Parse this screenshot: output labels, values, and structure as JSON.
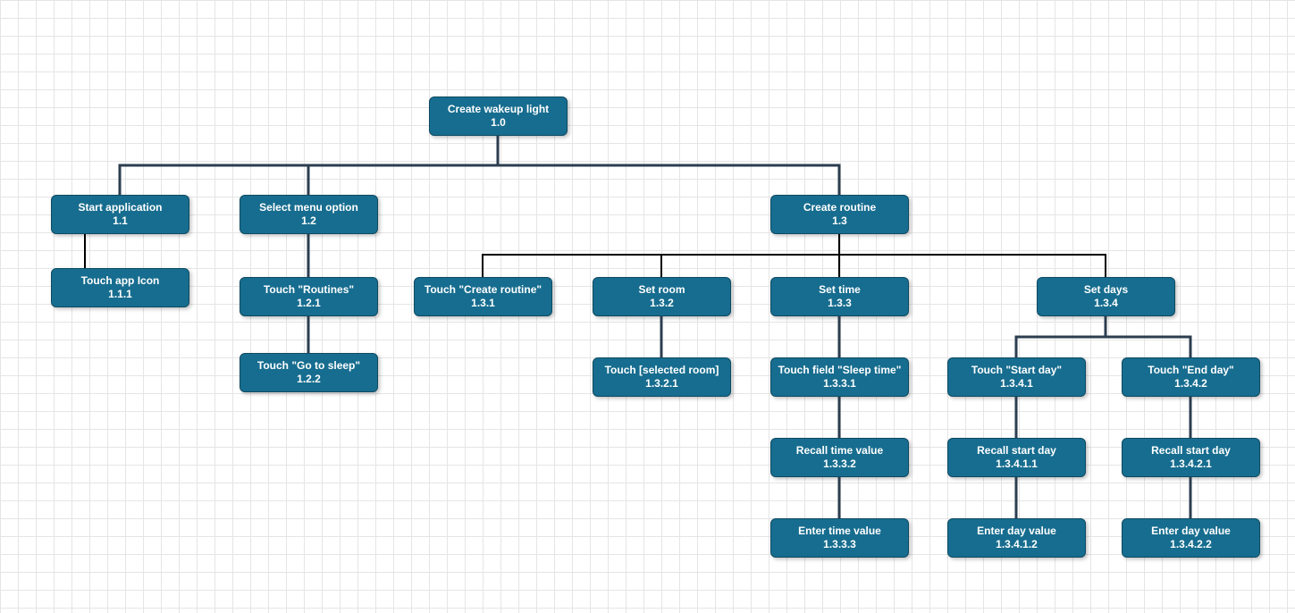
{
  "colors": {
    "node_fill": "#176D8F",
    "edge_stroke": "#2c3e50",
    "edge_alt_stroke": "#000000"
  },
  "nodes": {
    "n1_0": {
      "title": "Create wakeup light",
      "num": "1.0"
    },
    "n1_1": {
      "title": "Start application",
      "num": "1.1"
    },
    "n1_1_1": {
      "title": "Touch app Icon",
      "num": "1.1.1"
    },
    "n1_2": {
      "title": "Select menu option",
      "num": "1.2"
    },
    "n1_2_1": {
      "title": "Touch \"Routines\"",
      "num": "1.2.1"
    },
    "n1_2_2": {
      "title": "Touch \"Go to sleep\"",
      "num": "1.2.2"
    },
    "n1_3": {
      "title": "Create routine",
      "num": "1.3"
    },
    "n1_3_1": {
      "title": "Touch \"Create routine\"",
      "num": "1.3.1"
    },
    "n1_3_2": {
      "title": "Set room",
      "num": "1.3.2"
    },
    "n1_3_2_1": {
      "title": "Touch  [selected room]",
      "num": "1.3.2.1"
    },
    "n1_3_3": {
      "title": "Set time",
      "num": "1.3.3"
    },
    "n1_3_3_1": {
      "title": "Touch field \"Sleep time\"",
      "num": "1.3.3.1"
    },
    "n1_3_3_2": {
      "title": "Recall time value",
      "num": "1.3.3.2"
    },
    "n1_3_3_3": {
      "title": "Enter time value",
      "num": "1.3.3.3"
    },
    "n1_3_4": {
      "title": "Set days",
      "num": "1.3.4"
    },
    "n1_3_4_1": {
      "title": "Touch  \"Start day\"",
      "num": "1.3.4.1"
    },
    "n1_3_4_1_1": {
      "title": "Recall start day",
      "num": "1.3.4.1.1"
    },
    "n1_3_4_1_2": {
      "title": "Enter  day value",
      "num": "1.3.4.1.2"
    },
    "n1_3_4_2": {
      "title": "Touch  \"End day\"",
      "num": "1.3.4.2"
    },
    "n1_3_4_2_1": {
      "title": "Recall start day",
      "num": "1.3.4.2.1"
    },
    "n1_3_4_2_2": {
      "title": "Enter  day value",
      "num": "1.3.4.2.2"
    }
  }
}
